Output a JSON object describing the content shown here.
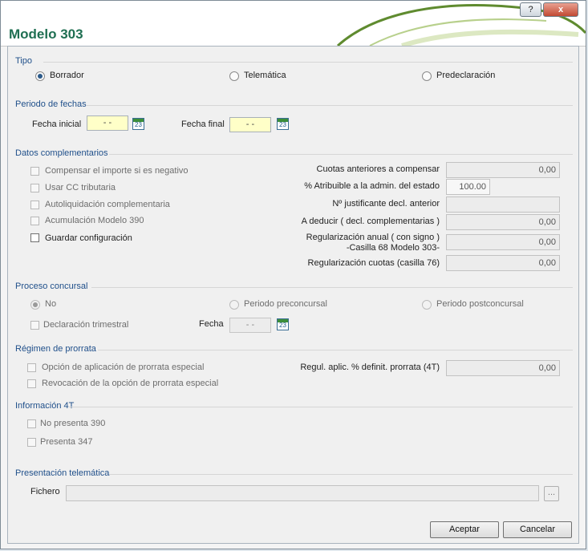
{
  "window": {
    "title": "Modelo 303",
    "help_label": "?",
    "close_label": "x"
  },
  "tipo": {
    "title": "Tipo",
    "options": [
      {
        "label": "Borrador",
        "selected": true
      },
      {
        "label": "Telemática",
        "selected": false
      },
      {
        "label": "Predeclaración",
        "selected": false
      }
    ]
  },
  "periodo": {
    "title": "Periodo de fechas",
    "fecha_inicial_label": "Fecha inicial",
    "fecha_inicial_value": "- -",
    "fecha_final_label": "Fecha final",
    "fecha_final_value": "- -",
    "calendar_text": "23"
  },
  "datos": {
    "title": "Datos complementarios",
    "checkboxes": [
      {
        "label": "Compensar el importe si es negativo",
        "enabled": false
      },
      {
        "label": "Usar CC tributaria",
        "enabled": false
      },
      {
        "label": "Autoliquidación complementaria",
        "enabled": false
      },
      {
        "label": "Acumulación Modelo 390",
        "enabled": false
      },
      {
        "label": "Guardar configuración",
        "enabled": true
      }
    ],
    "cuotas_label": "Cuotas anteriores a compensar",
    "cuotas_value": "0,00",
    "atribuible_label": "% Atribuible a la admin. del estado",
    "atribuible_value": "100.00",
    "justificante_label": "Nº justificante decl. anterior",
    "justificante_value": "",
    "deducir_label": "A deducir ( decl. complementarias )",
    "deducir_value": "0,00",
    "regularizacion_anual_label_1": "Regularización anual ( con signo )",
    "regularizacion_anual_label_2": "-Casilla 68 Modelo 303-",
    "regularizacion_anual_value": "0,00",
    "regularizacion_cuotas_label": "Regularización cuotas (casilla 76)",
    "regularizacion_cuotas_value": "0,00"
  },
  "proceso": {
    "title": "Proceso concursal",
    "options": [
      {
        "label": "No",
        "selected": true
      },
      {
        "label": "Periodo preconcursal",
        "selected": false
      },
      {
        "label": "Periodo postconcursal",
        "selected": false
      }
    ],
    "declaracion_label": "Declaración trimestral",
    "fecha_label": "Fecha",
    "fecha_value": "- -"
  },
  "prorrata": {
    "title": "Régimen de prorrata",
    "opcion_label": "Opción de aplicación de prorrata especial",
    "revocacion_label": "Revocación de la opción de prorrata especial",
    "regul_label": "Regul. aplic. % definit. prorrata (4T)",
    "regul_value": "0,00"
  },
  "info4t": {
    "title": "Información 4T",
    "no_presenta_label": "No presenta 390",
    "presenta_label": "Presenta 347"
  },
  "presentacion": {
    "title": "Presentación telemática",
    "fichero_label": "Fichero",
    "fichero_value": "",
    "browse_label": "..."
  },
  "buttons": {
    "accept_label": "Aceptar",
    "cancel_label": "Cancelar"
  }
}
